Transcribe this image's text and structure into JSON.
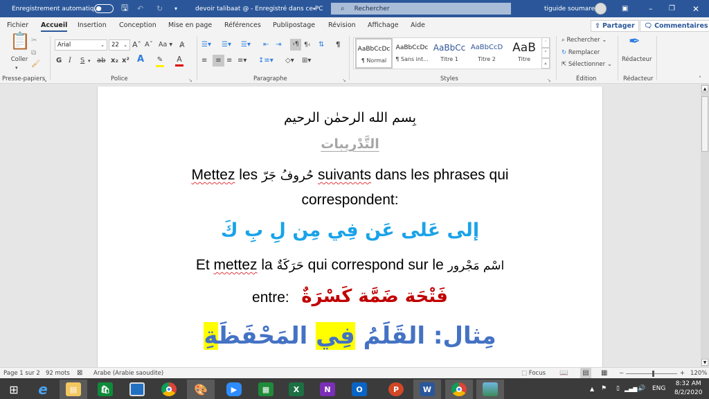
{
  "titlebar": {
    "autosave_label": "Enregistrement automatique",
    "doc_title": "devoir talibaat @ - Enregistré dans ce PC",
    "search_placeholder": "Rechercher",
    "user_name": "tiguide soumare",
    "icons": {
      "save": "save-icon",
      "undo": "undo-icon",
      "redo": "redo-icon",
      "customize": "customize-icon",
      "ribbon_display": "ribbon-display-icon",
      "minimize": "minimize-icon",
      "restore": "restore-icon",
      "close": "close-icon"
    }
  },
  "tabs": [
    {
      "label": "Fichier"
    },
    {
      "label": "Accueil",
      "active": true
    },
    {
      "label": "Insertion"
    },
    {
      "label": "Conception"
    },
    {
      "label": "Mise en page"
    },
    {
      "label": "Références"
    },
    {
      "label": "Publipostage"
    },
    {
      "label": "Révision"
    },
    {
      "label": "Affichage"
    },
    {
      "label": "Aide"
    }
  ],
  "share_label": "Partager",
  "comments_label": "Commentaires",
  "ribbon": {
    "clipboard": {
      "paste_label": "Coller",
      "group_label": "Presse-papiers"
    },
    "font": {
      "font_name": "Arial",
      "font_size": "22",
      "group_label": "Police",
      "bold": "G",
      "italic": "I",
      "underline": "S",
      "strike": "ab",
      "subscript": "x₂",
      "superscript": "x²",
      "change_case": "Aa"
    },
    "paragraph": {
      "group_label": "Paragraphe"
    },
    "styles": {
      "group_label": "Styles",
      "items": [
        {
          "preview": "AaBbCcDc",
          "name": "¶ Normal",
          "selected": true
        },
        {
          "preview": "AaBbCcDc",
          "name": "¶ Sans int..."
        },
        {
          "preview": "AaBbCc",
          "name": "Titre 1"
        },
        {
          "preview": "AaBbCcD",
          "name": "Titre 2"
        },
        {
          "preview": "AaB",
          "name": "Titre"
        }
      ]
    },
    "editing": {
      "find": "Rechercher",
      "replace": "Remplacer",
      "select": "Sélectionner",
      "group_label": "Édition"
    },
    "editor": {
      "label": "Rédacteur",
      "group_label": "Rédacteur"
    }
  },
  "document": {
    "basmala": "بِسم الله الرحمٰن الرحيم",
    "title": "التَّدْريبات",
    "instr1_a": "Mettez",
    "instr1_b": " les ",
    "instr1_ar": "حُروفُ جَرّ",
    "instr1_c": "suivants",
    "instr1_d": " dans les phrases qui",
    "instr1_line2": "correspondent:",
    "prepositions": "إلى عَلى عَن فِي مِن لِ بِ كَ",
    "instr2_a": "Et ",
    "instr2_b": "mettez",
    "instr2_c": " la ",
    "instr2_ar1": "حَرَكَةٌ",
    "instr2_d": " qui correspond sur le ",
    "instr2_ar2": "اسْم مَجْرور",
    "between_label": "entre:",
    "harakat": "فَتْحَة ضَمَّة كَسْرَةٌ",
    "example_prefix": "مِثال: القَلَمُ ",
    "example_fi": "فِي",
    "example_mid": " المَحْفَظَ",
    "example_end": "ةِ",
    "colors": {
      "prepositions": "#1aa3e8",
      "harakat": "#c00000",
      "example": "#4472c4",
      "title": "#a6a6a6",
      "highlight": "#ffff00"
    }
  },
  "statusbar": {
    "page": "Page 1 sur 2",
    "words": "92 mots",
    "language": "Arabe (Arabie saoudite)",
    "focus": "Focus",
    "zoom": "120%",
    "zoom_percent": 120
  },
  "taskbar": {
    "apps": [
      "Start",
      "Internet Explorer",
      "File Explorer",
      "Store",
      "Lenovo",
      "Chrome",
      "Paint",
      "Zoom",
      "Calculator",
      "Excel",
      "OneNote",
      "Outlook",
      "PowerPoint",
      "Word",
      "Chrome",
      "Photos"
    ],
    "language": "ENG",
    "time": "8:32 AM",
    "date": "8/2/2020"
  }
}
